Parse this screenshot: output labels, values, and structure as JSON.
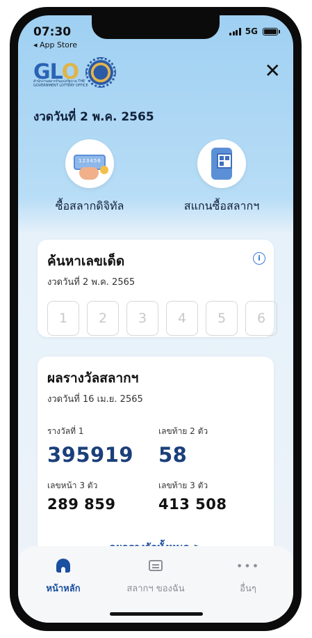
{
  "status_bar": {
    "time": "07:30",
    "back_label": "◂ App Store",
    "network": "5G"
  },
  "header": {
    "logo_text_main": "GL",
    "logo_text_accent": "O",
    "logo_sub": "สำนักงานสลากกินแบ่งรัฐบาล THE GOVERNMENT LOTTERY OFFICE",
    "close_label": "✕",
    "draw_date": "งวดวันที่ 2 พ.ค. 2565"
  },
  "actions": [
    {
      "label": "ซื้อสลากดิจิทัล",
      "icon": "digital-ticket-icon"
    },
    {
      "label": "สแกนซื้อสลากฯ",
      "icon": "qr-scan-icon"
    }
  ],
  "search_card": {
    "title": "ค้นหาเลขเด็ด",
    "date": "งวดวันที่  2 พ.ค. 2565",
    "info_icon": "i",
    "digits": [
      "1",
      "2",
      "3",
      "4",
      "5",
      "6"
    ]
  },
  "results_card": {
    "title": "ผลรางวัลสลากฯ",
    "date": "งวดวันที่  16 เม.ย. 2565",
    "first_prize_label": "รางวัลที่ 1",
    "first_prize_value": "395919",
    "last2_label": "เลขท้าย 2 ตัว",
    "last2_value": "58",
    "front3_label": "เลขหน้า 3 ตัว",
    "front3_value": "289  859",
    "last3_label": "เลขท้าย 3 ตัว",
    "last3_value": "413  508",
    "see_all": "ดูผลรางวัลทั้งหมด  >"
  },
  "bottom_nav": [
    {
      "label": "หน้าหลัก",
      "icon": "home-icon",
      "active": true
    },
    {
      "label": "สลากฯ ของฉัน",
      "icon": "tickets-icon",
      "active": false
    },
    {
      "label": "อื่นๆ",
      "icon": "more-icon",
      "active": false
    }
  ],
  "colors": {
    "accent": "#1b4fa0",
    "number_blue": "#1b3f7a",
    "header_gradient_top": "#9fd0f2"
  }
}
